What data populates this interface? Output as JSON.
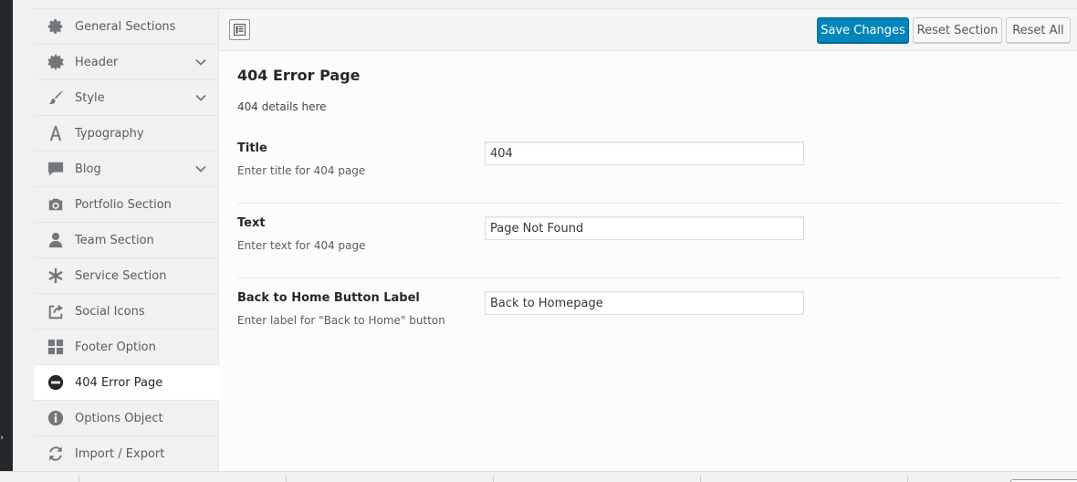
{
  "sidebar": {
    "items": [
      {
        "label": "General Sections",
        "icon": "gear-icon",
        "has_children": false,
        "active": false
      },
      {
        "label": "Header",
        "icon": "starburst-icon",
        "has_children": true,
        "active": false
      },
      {
        "label": "Style",
        "icon": "brush-icon",
        "has_children": true,
        "active": false
      },
      {
        "label": "Typography",
        "icon": "typography-icon",
        "has_children": false,
        "active": false
      },
      {
        "label": "Blog",
        "icon": "comment-icon",
        "has_children": true,
        "active": false
      },
      {
        "label": "Portfolio Section",
        "icon": "camera-icon",
        "has_children": false,
        "active": false
      },
      {
        "label": "Team Section",
        "icon": "person-icon",
        "has_children": false,
        "active": false
      },
      {
        "label": "Service Section",
        "icon": "asterisk-icon",
        "has_children": false,
        "active": false
      },
      {
        "label": "Social Icons",
        "icon": "share-icon",
        "has_children": false,
        "active": false
      },
      {
        "label": "Footer Option",
        "icon": "grid-icon",
        "has_children": false,
        "active": false
      },
      {
        "label": "404 Error Page",
        "icon": "minus-circle-icon",
        "has_children": false,
        "active": true
      },
      {
        "label": "Options Object",
        "icon": "info-icon",
        "has_children": false,
        "active": false
      },
      {
        "label": "Import / Export",
        "icon": "refresh-icon",
        "has_children": false,
        "active": false
      }
    ]
  },
  "toolbar": {
    "save_label": "Save Changes",
    "reset_section_label": "Reset Section",
    "reset_all_label": "Reset All"
  },
  "section": {
    "title": "404 Error Page",
    "description": "404 details here",
    "fields": [
      {
        "label": "Title",
        "description": "Enter title for 404 page",
        "value": "404"
      },
      {
        "label": "Text",
        "description": "Enter text for 404 page",
        "value": "Page Not Found"
      },
      {
        "label": "Back to Home Button Label",
        "description": "Enter label for \"Back to Home\" button",
        "value": "Back to Homepage"
      }
    ]
  },
  "colors": {
    "primary": "#0085ba",
    "sidebar_bg": "#f1f1f1",
    "admin_bar": "#23282d"
  }
}
